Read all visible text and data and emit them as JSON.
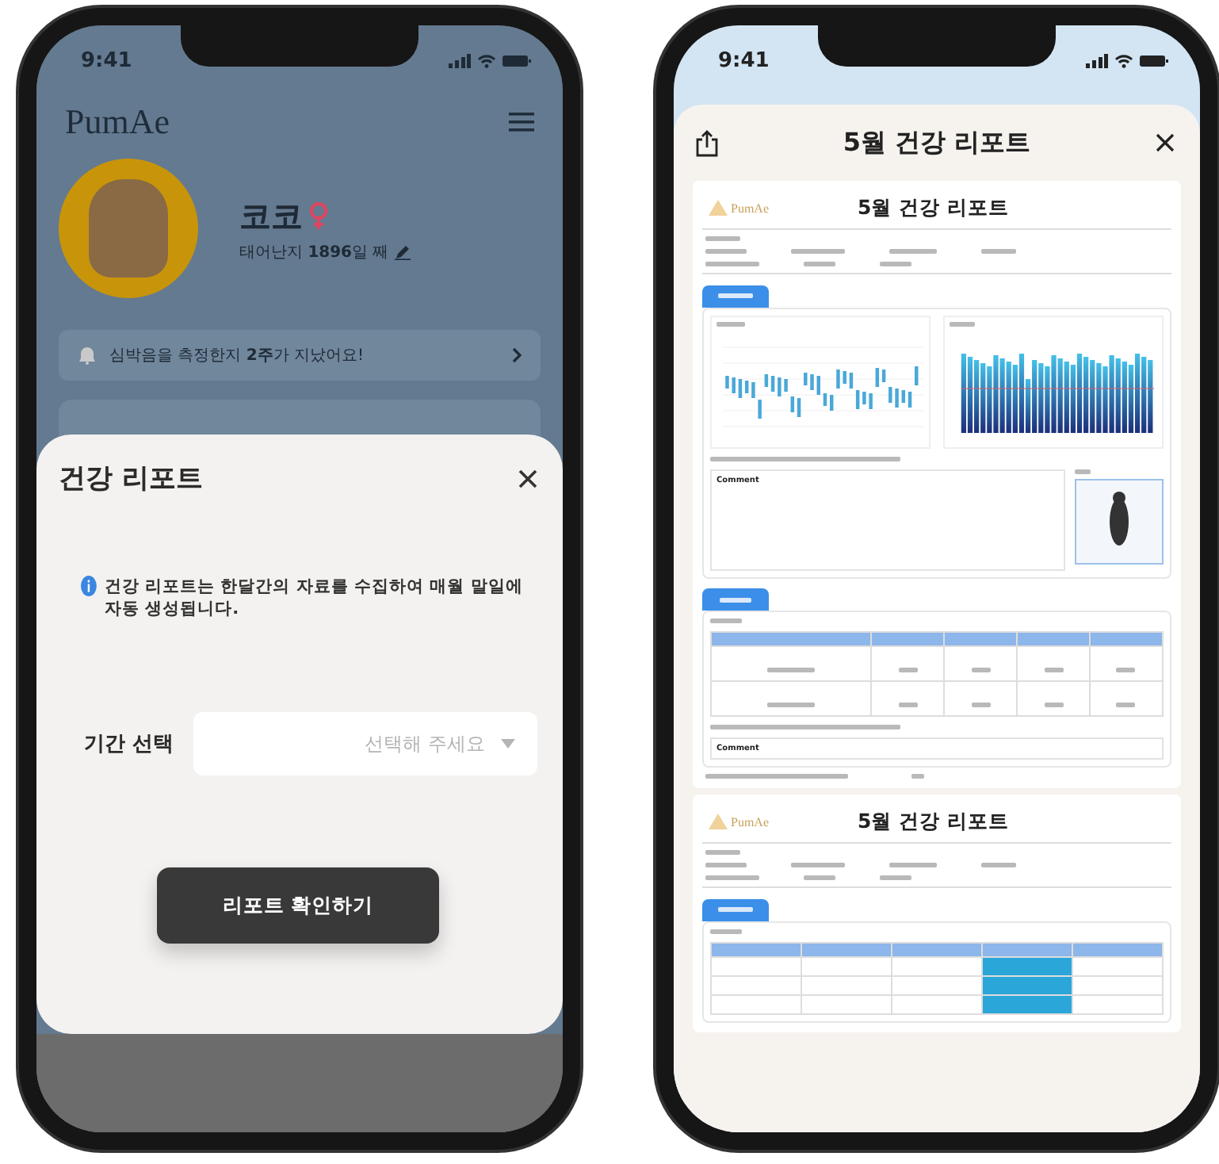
{
  "left_phone": {
    "status_time": "9:41",
    "app_title": "PumAe",
    "pet_name": "코코",
    "pet_age": "태어난지 **1896**일 째",
    "notice": "심박음을 측정한지 **2주**가 지났어요!",
    "sheet": {
      "title": "건강 리포트",
      "info": "건강 리포트는 한달간의 자료를 수집하여 매월 말일에 자동 생성됩니다.",
      "period_label": "기간 선택",
      "period_placeholder": "선택해 주세요",
      "button": "리포트 확인하기"
    }
  },
  "right_phone": {
    "status_time": "9:41",
    "title": "5월 건강 리포트",
    "pages": [
      {
        "logo": "PumAe",
        "title": "5월 건강 리포트",
        "comments": [
          "Comment",
          "Comment"
        ]
      },
      {
        "logo": "PumAe",
        "title": "5월 건강 리포트"
      }
    ]
  }
}
